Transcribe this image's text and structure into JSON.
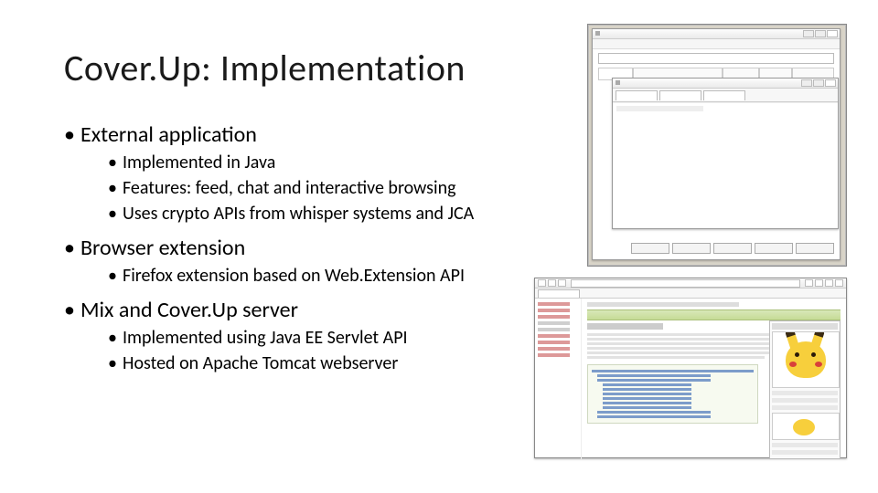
{
  "title": "Cover.Up: Implementation",
  "bullets": {
    "b1": {
      "label": "External application",
      "s1": "Implemented in Java",
      "s2": "Features: feed, chat and interactive browsing",
      "s3": "Uses crypto APIs from whisper systems and JCA"
    },
    "b2": {
      "label": "Browser extension",
      "s1": "Firefox extension based on Web.Extension API"
    },
    "b3": {
      "label": "Mix and Cover.Up server",
      "s1": "Implemented using Java EE Servlet API",
      "s2": "Hosted on Apache Tomcat webserver"
    }
  }
}
